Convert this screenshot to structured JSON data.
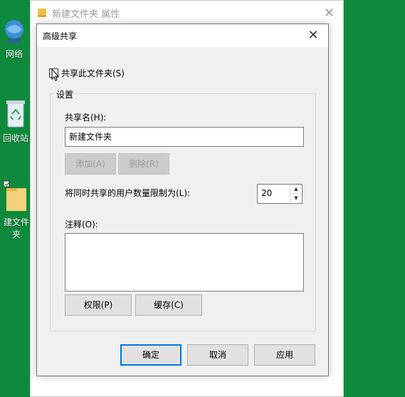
{
  "desktop": {
    "icons": [
      {
        "label": "网络",
        "icon": "network-icon"
      },
      {
        "label": "回收站",
        "icon": "recycle-bin-icon"
      },
      {
        "label": "建文件夹",
        "icon": "folder-icon"
      }
    ]
  },
  "background_window": {
    "title": "新建文件夹 属性"
  },
  "dialog": {
    "title": "高级共享",
    "share_checkbox_label": "共享此文件夹(S)",
    "settings_group_label": "设置",
    "share_name_label": "共享名(H):",
    "share_name_value": "新建文件夹",
    "add_button": "添加(A)",
    "remove_button": "删除(R)",
    "user_limit_label": "将同时共享的用户数量限制为(L):",
    "user_limit_value": "20",
    "comment_label": "注释(O):",
    "comment_value": "",
    "permissions_button": "权限(P)",
    "caching_button": "缓存(C)",
    "ok_button": "确定",
    "cancel_button": "取消",
    "apply_button": "应用"
  },
  "colors": {
    "desktop_bg": "#0f8a3c",
    "dialog_bg": "#f0f0f0",
    "default_button_border": "#0078d7"
  }
}
